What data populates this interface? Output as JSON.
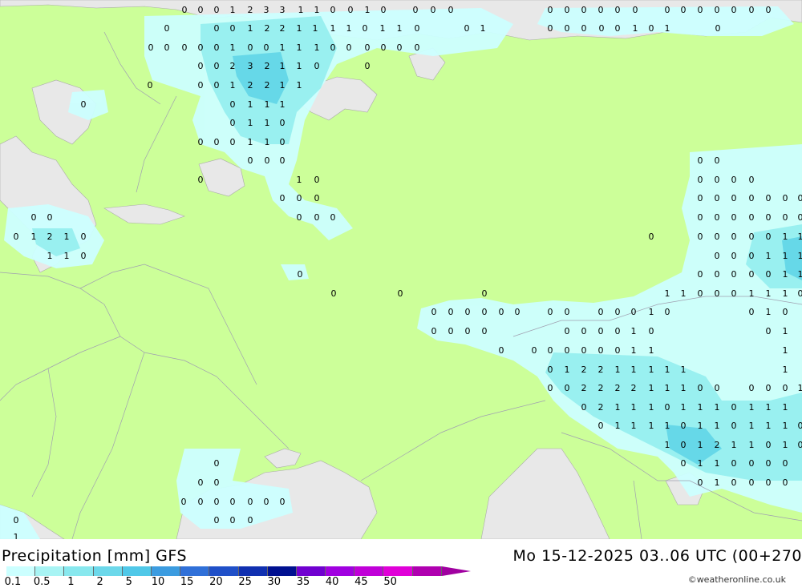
{
  "title": "Precipitation [mm] GFS",
  "timestamp": "Mo 15-12-2025 03..06 UTC (00+270",
  "credit": "©weatheronline.co.uk",
  "legend": {
    "ticks": [
      "0.1",
      "0.5",
      "1",
      "2",
      "5",
      "10",
      "15",
      "20",
      "25",
      "30",
      "35",
      "40",
      "45",
      "50"
    ],
    "colors": [
      "#ccffff",
      "#a8f4f4",
      "#88e8ee",
      "#6cd8ea",
      "#50c8e8",
      "#3c9ce0",
      "#3070d8",
      "#2050c8",
      "#1030b0",
      "#001090",
      "#7000d0",
      "#a000e0",
      "#c000d8",
      "#e000d8",
      "#b000b0"
    ],
    "arrow_color": "#a000a0"
  },
  "colors": {
    "land": "#ccff99",
    "water": "#e8e8e8",
    "precip_light": "#ccffff",
    "precip_mid": "#99f0f0",
    "precip_strong": "#66d8e8"
  },
  "map_labels": [
    [
      "0",
      230,
      12
    ],
    [
      "0",
      250,
      12
    ],
    [
      "0",
      270,
      12
    ],
    [
      "1",
      290,
      12
    ],
    [
      "2",
      312,
      12
    ],
    [
      "3",
      332,
      12
    ],
    [
      "3",
      352,
      12
    ],
    [
      "1",
      375,
      12
    ],
    [
      "1",
      395,
      12
    ],
    [
      "0",
      415,
      12
    ],
    [
      "0",
      437,
      12
    ],
    [
      "1",
      458,
      12
    ],
    [
      "0",
      478,
      12
    ],
    [
      "0",
      518,
      12
    ],
    [
      "0",
      540,
      12
    ],
    [
      "0",
      562,
      12
    ],
    [
      "0",
      686,
      12
    ],
    [
      "0",
      707,
      12
    ],
    [
      "0",
      728,
      12
    ],
    [
      "0",
      749,
      12
    ],
    [
      "0",
      770,
      12
    ],
    [
      "0",
      792,
      12
    ],
    [
      "0",
      832,
      12
    ],
    [
      "0",
      852,
      12
    ],
    [
      "0",
      873,
      12
    ],
    [
      "0",
      894,
      12
    ],
    [
      "0",
      915,
      12
    ],
    [
      "0",
      937,
      12
    ],
    [
      "0",
      958,
      12
    ],
    [
      "0",
      208,
      35
    ],
    [
      "0",
      270,
      35
    ],
    [
      "0",
      290,
      35
    ],
    [
      "1",
      312,
      35
    ],
    [
      "2",
      333,
      35
    ],
    [
      "2",
      352,
      35
    ],
    [
      "1",
      373,
      35
    ],
    [
      "1",
      393,
      35
    ],
    [
      "1",
      415,
      35
    ],
    [
      "1",
      435,
      35
    ],
    [
      "0",
      455,
      35
    ],
    [
      "1",
      477,
      35
    ],
    [
      "1",
      498,
      35
    ],
    [
      "0",
      520,
      35
    ],
    [
      "0",
      582,
      35
    ],
    [
      "1",
      602,
      35
    ],
    [
      "0",
      686,
      35
    ],
    [
      "0",
      707,
      35
    ],
    [
      "0",
      728,
      35
    ],
    [
      "0",
      750,
      35
    ],
    [
      "0",
      770,
      35
    ],
    [
      "1",
      792,
      35
    ],
    [
      "0",
      812,
      35
    ],
    [
      "1",
      832,
      35
    ],
    [
      "0",
      895,
      35
    ],
    [
      "0",
      188,
      59
    ],
    [
      "0",
      208,
      59
    ],
    [
      "0",
      230,
      59
    ],
    [
      "0",
      250,
      59
    ],
    [
      "0",
      270,
      59
    ],
    [
      "1",
      290,
      59
    ],
    [
      "0",
      312,
      59
    ],
    [
      "0",
      332,
      59
    ],
    [
      "1",
      352,
      59
    ],
    [
      "1",
      373,
      59
    ],
    [
      "1",
      395,
      59
    ],
    [
      "0",
      415,
      59
    ],
    [
      "0",
      435,
      59
    ],
    [
      "0",
      458,
      59
    ],
    [
      "0",
      478,
      59
    ],
    [
      "0",
      498,
      59
    ],
    [
      "0",
      520,
      59
    ],
    [
      "0",
      250,
      82
    ],
    [
      "0",
      270,
      82
    ],
    [
      "2",
      290,
      82
    ],
    [
      "3",
      312,
      82
    ],
    [
      "2",
      333,
      82
    ],
    [
      "1",
      352,
      82
    ],
    [
      "1",
      373,
      82
    ],
    [
      "0",
      395,
      82
    ],
    [
      "0",
      458,
      82
    ],
    [
      "0",
      187,
      106
    ],
    [
      "0",
      250,
      106
    ],
    [
      "0",
      270,
      106
    ],
    [
      "1",
      290,
      106
    ],
    [
      "2",
      312,
      106
    ],
    [
      "2",
      333,
      106
    ],
    [
      "1",
      352,
      106
    ],
    [
      "1",
      373,
      106
    ],
    [
      "0",
      104,
      130
    ],
    [
      "0",
      290,
      130
    ],
    [
      "1",
      312,
      130
    ],
    [
      "1",
      333,
      130
    ],
    [
      "1",
      352,
      130
    ],
    [
      "0",
      290,
      153
    ],
    [
      "1",
      312,
      153
    ],
    [
      "1",
      333,
      153
    ],
    [
      "0",
      352,
      153
    ],
    [
      "0",
      250,
      177
    ],
    [
      "0",
      270,
      177
    ],
    [
      "0",
      290,
      177
    ],
    [
      "1",
      312,
      177
    ],
    [
      "1",
      333,
      177
    ],
    [
      "0",
      352,
      177
    ],
    [
      "0",
      312,
      200
    ],
    [
      "0",
      333,
      200
    ],
    [
      "0",
      352,
      200
    ],
    [
      "0",
      873,
      200
    ],
    [
      "0",
      894,
      200
    ],
    [
      "0",
      250,
      224
    ],
    [
      "1",
      373,
      224
    ],
    [
      "0",
      395,
      224
    ],
    [
      "0",
      873,
      224
    ],
    [
      "0",
      894,
      224
    ],
    [
      "0",
      915,
      224
    ],
    [
      "0",
      937,
      224
    ],
    [
      "0",
      352,
      247
    ],
    [
      "0",
      373,
      247
    ],
    [
      "0",
      395,
      247
    ],
    [
      "0",
      873,
      247
    ],
    [
      "0",
      894,
      247
    ],
    [
      "0",
      915,
      247
    ],
    [
      "0",
      937,
      247
    ],
    [
      "0",
      958,
      247
    ],
    [
      "0",
      979,
      247
    ],
    [
      "0",
      998,
      247
    ],
    [
      "0",
      42,
      271
    ],
    [
      "0",
      62,
      271
    ],
    [
      "0",
      373,
      271
    ],
    [
      "0",
      395,
      271
    ],
    [
      "0",
      415,
      271
    ],
    [
      "0",
      873,
      271
    ],
    [
      "0",
      894,
      271
    ],
    [
      "0",
      915,
      271
    ],
    [
      "0",
      937,
      271
    ],
    [
      "0",
      958,
      271
    ],
    [
      "0",
      979,
      271
    ],
    [
      "0",
      998,
      271
    ],
    [
      "0",
      20,
      295
    ],
    [
      "1",
      42,
      295
    ],
    [
      "2",
      62,
      295
    ],
    [
      "1",
      83,
      295
    ],
    [
      "0",
      104,
      295
    ],
    [
      "0",
      812,
      295
    ],
    [
      "0",
      873,
      295
    ],
    [
      "0",
      894,
      295
    ],
    [
      "0",
      915,
      295
    ],
    [
      "0",
      937,
      295
    ],
    [
      "0",
      958,
      295
    ],
    [
      "1",
      979,
      295
    ],
    [
      "1",
      998,
      295
    ],
    [
      "1",
      62,
      319
    ],
    [
      "1",
      83,
      319
    ],
    [
      "0",
      104,
      319
    ],
    [
      "0",
      894,
      319
    ],
    [
      "0",
      915,
      319
    ],
    [
      "0",
      937,
      319
    ],
    [
      "1",
      958,
      319
    ],
    [
      "1",
      979,
      319
    ],
    [
      "1",
      998,
      319
    ],
    [
      "0",
      374,
      342
    ],
    [
      "0",
      873,
      342
    ],
    [
      "0",
      894,
      342
    ],
    [
      "0",
      915,
      342
    ],
    [
      "0",
      937,
      342
    ],
    [
      "0",
      958,
      342
    ],
    [
      "1",
      979,
      342
    ],
    [
      "1",
      998,
      342
    ],
    [
      "0",
      416,
      366
    ],
    [
      "0",
      499,
      366
    ],
    [
      "0",
      604,
      366
    ],
    [
      "1",
      832,
      366
    ],
    [
      "1",
      852,
      366
    ],
    [
      "0",
      873,
      366
    ],
    [
      "0",
      894,
      366
    ],
    [
      "0",
      915,
      366
    ],
    [
      "1",
      937,
      366
    ],
    [
      "1",
      958,
      366
    ],
    [
      "1",
      979,
      366
    ],
    [
      "0",
      998,
      366
    ],
    [
      "0",
      541,
      389
    ],
    [
      "0",
      562,
      389
    ],
    [
      "0",
      583,
      389
    ],
    [
      "0",
      604,
      389
    ],
    [
      "0",
      625,
      389
    ],
    [
      "0",
      645,
      389
    ],
    [
      "0",
      686,
      389
    ],
    [
      "0",
      707,
      389
    ],
    [
      "0",
      749,
      389
    ],
    [
      "0",
      770,
      389
    ],
    [
      "0",
      790,
      389
    ],
    [
      "1",
      812,
      389
    ],
    [
      "0",
      832,
      389
    ],
    [
      "0",
      937,
      389
    ],
    [
      "1",
      958,
      389
    ],
    [
      "0",
      979,
      389
    ],
    [
      "0",
      541,
      413
    ],
    [
      "0",
      562,
      413
    ],
    [
      "0",
      583,
      413
    ],
    [
      "0",
      604,
      413
    ],
    [
      "0",
      707,
      413
    ],
    [
      "0",
      728,
      413
    ],
    [
      "0",
      749,
      413
    ],
    [
      "0",
      770,
      413
    ],
    [
      "1",
      790,
      413
    ],
    [
      "0",
      812,
      413
    ],
    [
      "0",
      958,
      413
    ],
    [
      "1",
      979,
      413
    ],
    [
      "0",
      625,
      437
    ],
    [
      "0",
      666,
      437
    ],
    [
      "0",
      686,
      437
    ],
    [
      "0",
      707,
      437
    ],
    [
      "0",
      728,
      437
    ],
    [
      "0",
      749,
      437
    ],
    [
      "0",
      770,
      437
    ],
    [
      "1",
      790,
      437
    ],
    [
      "1",
      812,
      437
    ],
    [
      "1",
      979,
      437
    ],
    [
      "0",
      686,
      461
    ],
    [
      "1",
      707,
      461
    ],
    [
      "2",
      728,
      461
    ],
    [
      "2",
      749,
      461
    ],
    [
      "1",
      770,
      461
    ],
    [
      "1",
      790,
      461
    ],
    [
      "1",
      812,
      461
    ],
    [
      "1",
      832,
      461
    ],
    [
      "1",
      852,
      461
    ],
    [
      "1",
      979,
      461
    ],
    [
      "0",
      686,
      484
    ],
    [
      "0",
      707,
      484
    ],
    [
      "2",
      728,
      484
    ],
    [
      "2",
      749,
      484
    ],
    [
      "2",
      770,
      484
    ],
    [
      "2",
      790,
      484
    ],
    [
      "1",
      812,
      484
    ],
    [
      "1",
      832,
      484
    ],
    [
      "1",
      852,
      484
    ],
    [
      "0",
      873,
      484
    ],
    [
      "0",
      894,
      484
    ],
    [
      "0",
      937,
      484
    ],
    [
      "0",
      958,
      484
    ],
    [
      "0",
      979,
      484
    ],
    [
      "1",
      998,
      484
    ],
    [
      "0",
      728,
      508
    ],
    [
      "2",
      749,
      508
    ],
    [
      "1",
      770,
      508
    ],
    [
      "1",
      790,
      508
    ],
    [
      "1",
      812,
      508
    ],
    [
      "0",
      832,
      508
    ],
    [
      "1",
      852,
      508
    ],
    [
      "1",
      873,
      508
    ],
    [
      "1",
      894,
      508
    ],
    [
      "0",
      915,
      508
    ],
    [
      "1",
      937,
      508
    ],
    [
      "1",
      958,
      508
    ],
    [
      "1",
      979,
      508
    ],
    [
      "0",
      749,
      531
    ],
    [
      "1",
      770,
      531
    ],
    [
      "1",
      790,
      531
    ],
    [
      "1",
      812,
      531
    ],
    [
      "1",
      832,
      531
    ],
    [
      "0",
      852,
      531
    ],
    [
      "1",
      873,
      531
    ],
    [
      "1",
      894,
      531
    ],
    [
      "0",
      915,
      531
    ],
    [
      "1",
      937,
      531
    ],
    [
      "1",
      958,
      531
    ],
    [
      "1",
      979,
      531
    ],
    [
      "0",
      998,
      531
    ],
    [
      "1",
      832,
      555
    ],
    [
      "0",
      852,
      555
    ],
    [
      "1",
      873,
      555
    ],
    [
      "2",
      894,
      555
    ],
    [
      "1",
      915,
      555
    ],
    [
      "1",
      937,
      555
    ],
    [
      "0",
      958,
      555
    ],
    [
      "1",
      979,
      555
    ],
    [
      "0",
      998,
      555
    ],
    [
      "0",
      270,
      578
    ],
    [
      "0",
      852,
      578
    ],
    [
      "1",
      873,
      578
    ],
    [
      "1",
      894,
      578
    ],
    [
      "0",
      915,
      578
    ],
    [
      "0",
      937,
      578
    ],
    [
      "0",
      958,
      578
    ],
    [
      "0",
      979,
      578
    ],
    [
      "0",
      250,
      602
    ],
    [
      "0",
      270,
      602
    ],
    [
      "0",
      873,
      602
    ],
    [
      "1",
      894,
      602
    ],
    [
      "0",
      915,
      602
    ],
    [
      "0",
      937,
      602
    ],
    [
      "0",
      958,
      602
    ],
    [
      "0",
      979,
      602
    ],
    [
      "0",
      229,
      626
    ],
    [
      "0",
      250,
      626
    ],
    [
      "0",
      270,
      626
    ],
    [
      "0",
      290,
      626
    ],
    [
      "0",
      312,
      626
    ],
    [
      "0",
      332,
      626
    ],
    [
      "0",
      352,
      626
    ],
    [
      "0",
      270,
      649
    ],
    [
      "0",
      290,
      649
    ],
    [
      "0",
      312,
      649
    ],
    [
      "0",
      20,
      649
    ],
    [
      "1",
      20,
      670
    ]
  ]
}
